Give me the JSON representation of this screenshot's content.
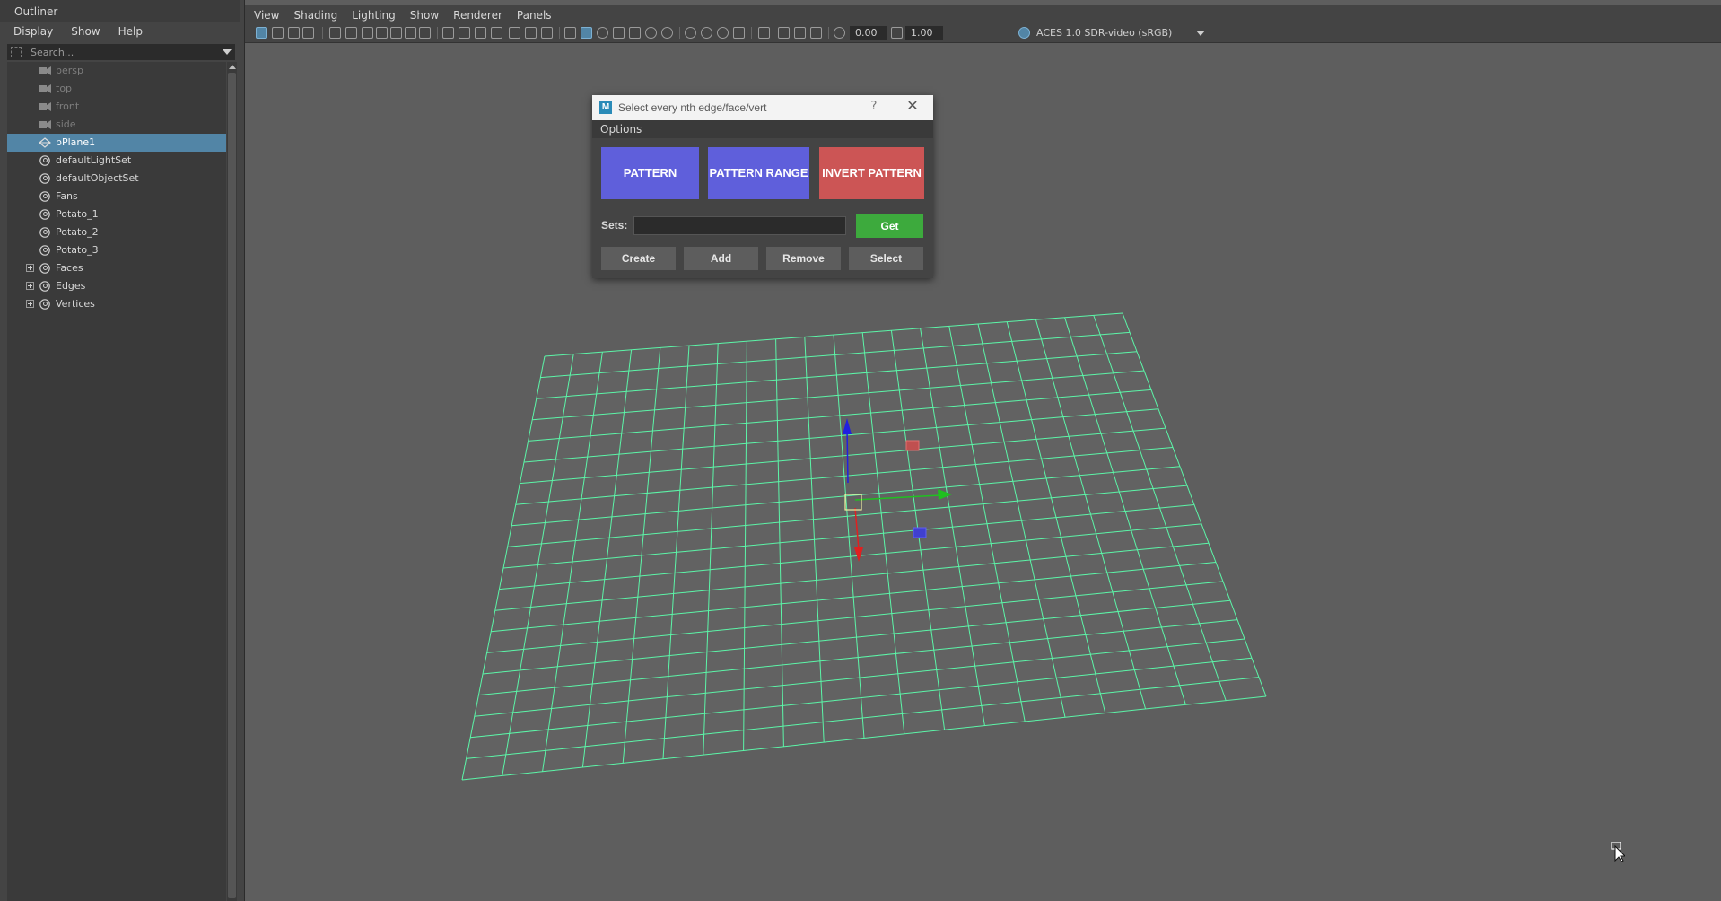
{
  "outliner": {
    "title": "Outliner",
    "menu": [
      "Display",
      "Show",
      "Help"
    ],
    "search_placeholder": "Search...",
    "items": [
      {
        "label": "persp",
        "icon": "camera-icon",
        "dim": true
      },
      {
        "label": "top",
        "icon": "camera-icon",
        "dim": true
      },
      {
        "label": "front",
        "icon": "camera-icon",
        "dim": true
      },
      {
        "label": "side",
        "icon": "camera-icon",
        "dim": true
      },
      {
        "label": "pPlane1",
        "icon": "mesh-icon",
        "selected": true
      },
      {
        "label": "defaultLightSet",
        "icon": "set-icon"
      },
      {
        "label": "defaultObjectSet",
        "icon": "set-icon"
      },
      {
        "label": "Fans",
        "icon": "set-icon"
      },
      {
        "label": "Potato_1",
        "icon": "set-icon"
      },
      {
        "label": "Potato_2",
        "icon": "set-icon"
      },
      {
        "label": "Potato_3",
        "icon": "set-icon"
      },
      {
        "label": "Faces",
        "icon": "set-icon",
        "expandable": true
      },
      {
        "label": "Edges",
        "icon": "set-icon",
        "expandable": true
      },
      {
        "label": "Vertices",
        "icon": "set-icon",
        "expandable": true
      }
    ]
  },
  "viewport": {
    "menu": [
      "View",
      "Shading",
      "Lighting",
      "Show",
      "Renderer",
      "Panels"
    ],
    "exposure": "0.00",
    "gamma": "1.00",
    "colorspace": "ACES 1.0 SDR-video (sRGB)",
    "wire_color": "#5cf5a8",
    "background_color": "#5e5e5e"
  },
  "dialog": {
    "title": "Select every nth edge/face/vert",
    "help": "?",
    "close": "✕",
    "app_icon_letter": "M",
    "options_menu": "Options",
    "pattern": "PATTERN",
    "pattern_range": "PATTERN RANGE",
    "invert_pattern": "INVERT PATTERN",
    "sets_label": "Sets:",
    "sets_value": "",
    "get": "Get",
    "create": "Create",
    "add": "Add",
    "remove": "Remove",
    "select": "Select",
    "colors": {
      "pattern": "#5f5fdb",
      "invert": "#cc5555",
      "get": "#3daa3d"
    }
  }
}
